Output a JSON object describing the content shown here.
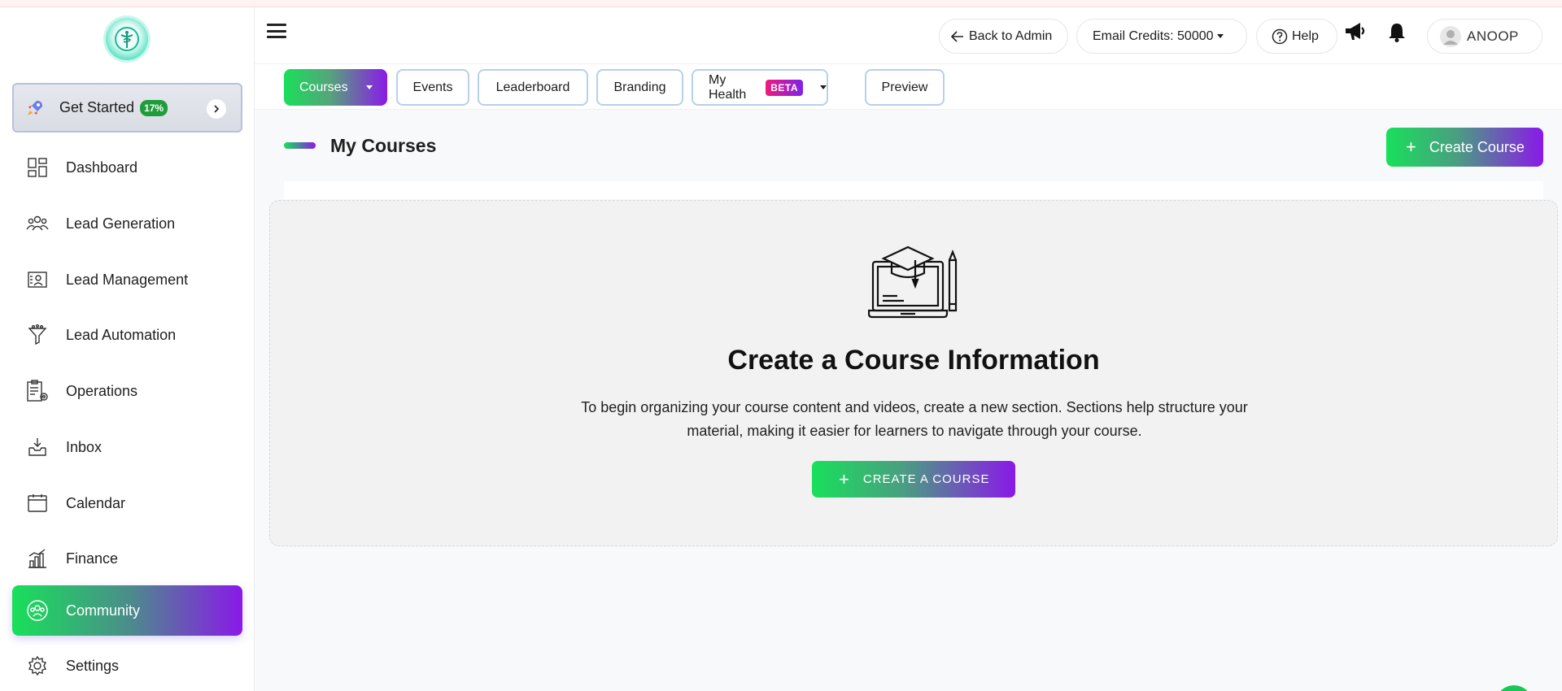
{
  "sidebar": {
    "get_started": {
      "label": "Get Started",
      "badge": "17%"
    },
    "items": [
      {
        "label": "Dashboard",
        "icon": "dashboard-icon"
      },
      {
        "label": "Lead Generation",
        "icon": "users-icon"
      },
      {
        "label": "Lead Management",
        "icon": "contact-card-icon"
      },
      {
        "label": "Lead Automation",
        "icon": "funnel-icon"
      },
      {
        "label": "Operations",
        "icon": "clipboard-gear-icon"
      },
      {
        "label": "Inbox",
        "icon": "inbox-icon"
      },
      {
        "label": "Calendar",
        "icon": "calendar-icon"
      },
      {
        "label": "Finance",
        "icon": "finance-chart-icon"
      },
      {
        "label": "Community",
        "icon": "community-icon",
        "active": true
      },
      {
        "label": "Settings",
        "icon": "gear-icon"
      }
    ]
  },
  "header": {
    "back_label": "Back to Admin",
    "email_credits": "Email Credits: 50000",
    "help_label": "Help",
    "user_name": "ANOOP"
  },
  "tabs": [
    {
      "label": "Courses",
      "active": true,
      "dropdown": true
    },
    {
      "label": "Events"
    },
    {
      "label": "Leaderboard"
    },
    {
      "label": "Branding"
    },
    {
      "label": "My Health",
      "badge": "BETA",
      "dropdown": true
    },
    {
      "label": "Preview"
    }
  ],
  "main": {
    "title": "My Courses",
    "create_button": "Create Course",
    "empty_state": {
      "title": "Create a Course Information",
      "description_line1": "To begin organizing your course content and videos, create a new section. Sections help structure your",
      "description_line2": "material, making it easier for learners to navigate through your course.",
      "cta": "CREATE A COURSE"
    }
  },
  "colors": {
    "accent_green": "#18e05a",
    "accent_purple": "#8a19e8",
    "badge_green": "#1f9d3a"
  }
}
